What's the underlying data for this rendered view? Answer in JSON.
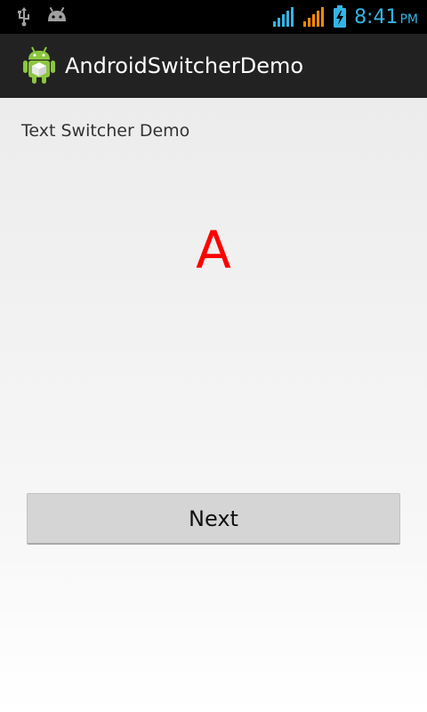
{
  "status_bar": {
    "time": "8:41",
    "ampm": "PM",
    "icons": [
      "usb-icon",
      "android-notification-icon",
      "signal-icon",
      "signal-icon",
      "battery-charging-icon"
    ],
    "colors": {
      "signal_blue": "#33b5e5",
      "signal_orange": "#ff8a00"
    }
  },
  "action_bar": {
    "title": "AndroidSwitcherDemo",
    "icon": "app-launcher-icon"
  },
  "content": {
    "heading": "Text Switcher Demo",
    "switcher_text": "A",
    "switcher_color": "#ff0000",
    "next_button_label": "Next"
  }
}
